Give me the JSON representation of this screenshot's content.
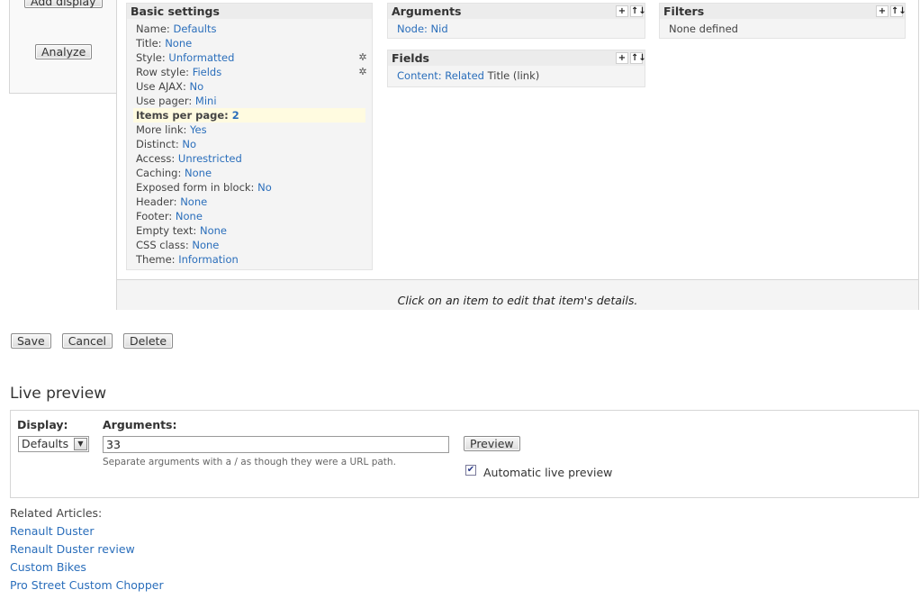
{
  "left": {
    "add_display_label": "Add display",
    "analyze_label": "Analyze"
  },
  "basic_settings": {
    "title": "Basic settings",
    "rows": [
      {
        "label": "Name:",
        "value": "Defaults"
      },
      {
        "label": "Title:",
        "value": "None"
      },
      {
        "label": "Style:",
        "value": "Unformatted"
      },
      {
        "label": "Row style:",
        "value": "Fields"
      },
      {
        "label": "Use AJAX:",
        "value": "No"
      },
      {
        "label": "Use pager:",
        "value": "Mini"
      },
      {
        "label": "Items per page:",
        "value": "2"
      },
      {
        "label": "More link:",
        "value": "Yes"
      },
      {
        "label": "Distinct:",
        "value": "No"
      },
      {
        "label": "Access:",
        "value": "Unrestricted"
      },
      {
        "label": "Caching:",
        "value": "None"
      },
      {
        "label": "Exposed form in block:",
        "value": "No"
      },
      {
        "label": "Header:",
        "value": "None"
      },
      {
        "label": "Footer:",
        "value": "None"
      },
      {
        "label": "Empty text:",
        "value": "None"
      },
      {
        "label": "CSS class:",
        "value": "None"
      },
      {
        "label": "Theme:",
        "value": "Information"
      }
    ]
  },
  "arguments": {
    "title": "Arguments",
    "item": "Node: Nid"
  },
  "fields": {
    "title": "Fields",
    "item_link": "Content: Related",
    "item_text": "Title (link)"
  },
  "filters": {
    "title": "Filters",
    "empty": "None defined"
  },
  "tools": {
    "add": "+",
    "rearrange": "↑↓",
    "gear": "✲"
  },
  "details_hint": "Click on an item to edit that item's details.",
  "actions": {
    "save": "Save",
    "cancel": "Cancel",
    "delete": "Delete"
  },
  "live_preview": {
    "title": "Live preview",
    "display_label": "Display:",
    "display_value": "Defaults",
    "arguments_label": "Arguments:",
    "arguments_value": "33",
    "arguments_help": "Separate arguments with a / as though they were a URL path.",
    "preview_button": "Preview",
    "auto_preview_label": "Automatic live preview",
    "auto_preview_checked": true
  },
  "related": {
    "title": "Related Articles:",
    "items": [
      "Renault Duster",
      "Renault Duster review",
      "Custom Bikes",
      "Pro Street Custom Chopper"
    ]
  }
}
